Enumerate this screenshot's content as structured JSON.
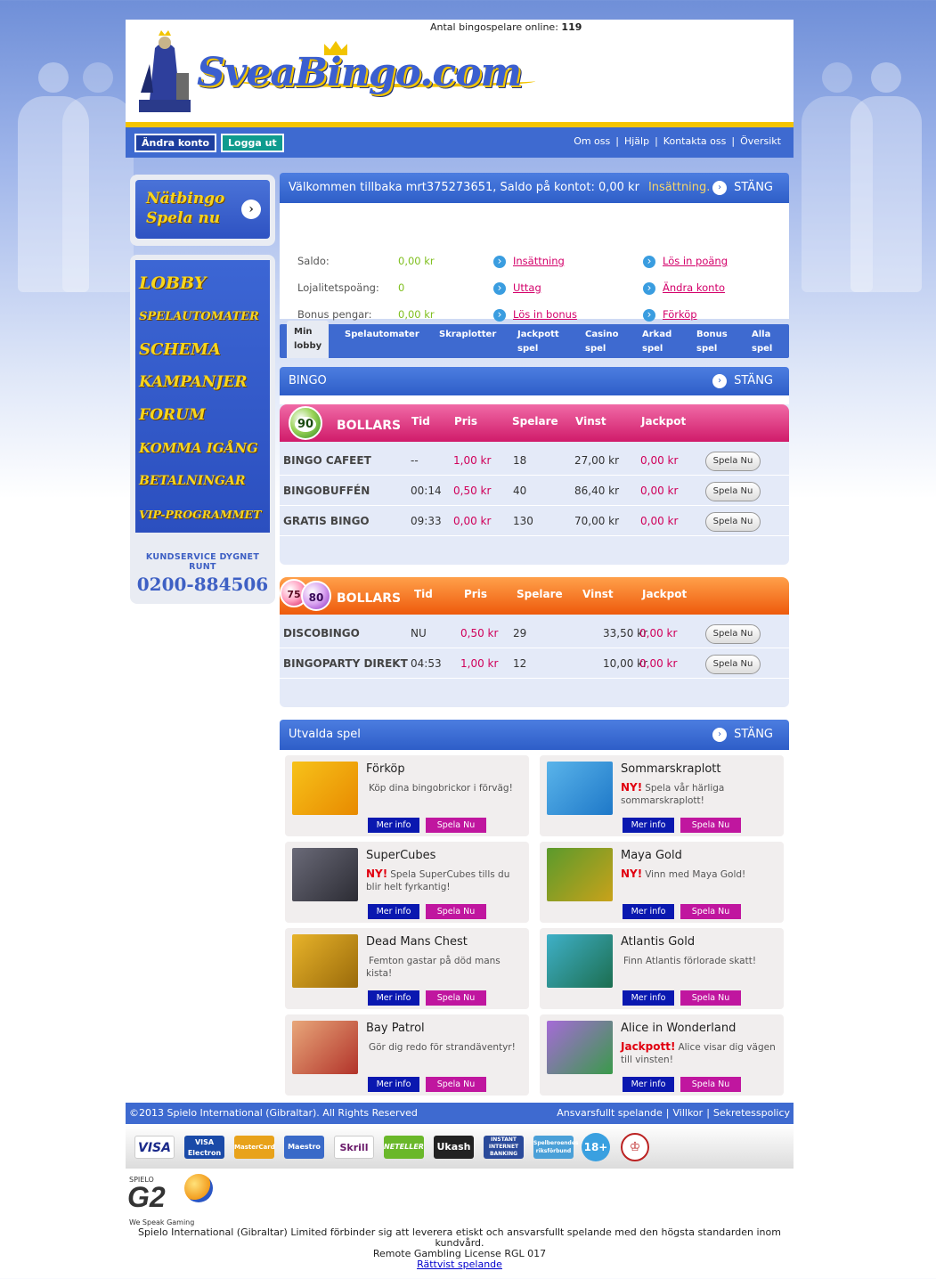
{
  "header": {
    "online_label": "Antal bingospelare online:",
    "online_count": "119",
    "logo_text": "SveaBingo.com"
  },
  "nav": {
    "andra_konto": "Ändra konto",
    "logga_ut": "Logga ut",
    "links": [
      "Om oss",
      "Hjälp",
      "Kontakta oss",
      "Översikt"
    ]
  },
  "left": {
    "natbingo_line1": "Nätbingo",
    "natbingo_line2": "Spela nu",
    "menu": [
      "LOBBY",
      "SPELAUTOMATER",
      "SCHEMA",
      "KAMPANJER",
      "FORUM",
      "KOMMA IGÅNG",
      "BETALNINGAR",
      "VIP-PROGRAMMET"
    ],
    "kundservice_label": "KUNDSERVICE DYGNET RUNT",
    "kundservice_phone": "0200-884506"
  },
  "welcome": {
    "text": "Välkommen tillbaka mrt375273651, Saldo på kontot: 0,00 kr",
    "insattning": "Insättning.",
    "stang": "STÄNG"
  },
  "account": {
    "rows": [
      {
        "label": "Saldo:",
        "value": "0,00 kr",
        "link1": "Insättning",
        "link2": "Lös in poäng"
      },
      {
        "label": "Lojalitetspoäng:",
        "value": "0",
        "link1": "Uttag",
        "link2": "Ändra konto"
      },
      {
        "label": "Bonus pengar:",
        "value": "0,00 kr",
        "link1": "Lös in bonus",
        "link2": "Förköp"
      }
    ]
  },
  "tabs": [
    {
      "line1": "Min",
      "line2": "lobby"
    },
    {
      "line1": "Spelautomater",
      "line2": ""
    },
    {
      "line1": "Skraplotter",
      "line2": ""
    },
    {
      "line1": "Jackpott",
      "line2": "spel"
    },
    {
      "line1": "Casino",
      "line2": "spel"
    },
    {
      "line1": "Arkad",
      "line2": "spel"
    },
    {
      "line1": "Bonus",
      "line2": "spel"
    },
    {
      "line1": "Alla",
      "line2": "spel"
    }
  ],
  "bingo": {
    "title": "BINGO",
    "stang": "STÄNG",
    "headers": {
      "bollars": "BOLLARS",
      "tid": "Tid",
      "pris": "Pris",
      "spelare": "Spelare",
      "vinst": "Vinst",
      "jackpot": "Jackpot"
    },
    "ball90": "90",
    "ball75": "75",
    "ball80": "80",
    "play_label": "Spela Nu",
    "rooms90": [
      {
        "name": "BINGO CAFEET",
        "tid": "--",
        "pris": "1,00 kr",
        "spelare": "18",
        "vinst": "27,00 kr",
        "jackpot": "0,00 kr"
      },
      {
        "name": "BINGOBUFFÉN",
        "tid": "00:14",
        "pris": "0,50 kr",
        "spelare": "40",
        "vinst": "86,40 kr",
        "jackpot": "0,00 kr"
      },
      {
        "name": "GRATIS BINGO",
        "tid": "09:33",
        "pris": "0,00 kr",
        "spelare": "130",
        "vinst": "70,00 kr",
        "jackpot": "0,00 kr"
      }
    ],
    "rooms75": [
      {
        "name": "DISCOBINGO",
        "tid": "NU",
        "pris": "0,50 kr",
        "spelare": "29",
        "vinst": "33,50 kr",
        "jackpot": "0,00 kr"
      },
      {
        "name": "BINGOPARTY DIREKT",
        "tid": "04:53",
        "pris": "1,00 kr",
        "spelare": "12",
        "vinst": "10,00 kr",
        "jackpot": "0,00 kr"
      }
    ]
  },
  "featured": {
    "title": "Utvalda spel",
    "stang": "STÄNG",
    "mer_info": "Mer info",
    "spela_nu": "Spela Nu",
    "games": [
      {
        "title": "Förköp",
        "ny": "",
        "desc": "Köp dina bingobrickor i förväg!",
        "color1": "#f7c21a",
        "color2": "#e88a00"
      },
      {
        "title": "Sommarskraplott",
        "ny": "NY!",
        "desc": "Spela vår härliga sommarskraplott!",
        "color1": "#5ab4ea",
        "color2": "#1e78c8"
      },
      {
        "title": "SuperCubes",
        "ny": "NY!",
        "desc": "Spela SuperCubes tills du blir helt fyrkantig!",
        "color1": "#6a6a78",
        "color2": "#2c2c34"
      },
      {
        "title": "Maya Gold",
        "ny": "NY!",
        "desc": "Vinn med Maya Gold!",
        "color1": "#5a9a2c",
        "color2": "#c9a21a"
      },
      {
        "title": "Dead Mans Chest",
        "ny": "",
        "desc": "Femton gastar på död mans kista!",
        "color1": "#e7b32a",
        "color2": "#9a6a0a"
      },
      {
        "title": "Atlantis Gold",
        "ny": "",
        "desc": "Finn Atlantis förlorade skatt!",
        "color1": "#3fb0c8",
        "color2": "#1c6e50"
      },
      {
        "title": "Bay Patrol",
        "ny": "",
        "desc": "Gör dig redo för strandäventyr!",
        "color1": "#e8a77a",
        "color2": "#b2332a"
      },
      {
        "title": "Alice in Wonderland",
        "ny": "Jackpott!",
        "desc": "Alice visar dig vägen till vinsten!",
        "color1": "#a66ad8",
        "color2": "#3a9a4a"
      }
    ]
  },
  "footer": {
    "copyright": "©2013 Spielo International (Gibraltar). All Rights Reserved",
    "links": [
      "Ansvarsfullt spelande",
      "Villkor",
      "Sekretesspolicy"
    ],
    "payments": [
      "VISA",
      "VISA Electron",
      "MasterCard",
      "Maestro",
      "Skrill",
      "NETELLER",
      "Ukash",
      "INSTANT INTERNET BANKING",
      "Spelberoendes riksförbund",
      "18+",
      "crest"
    ],
    "g2_sp": "SPIELO",
    "g2": "G2",
    "g2_tag": "We Speak Gaming",
    "legal1": "Spielo International (Gibraltar) Limited förbinder sig att leverera etiskt och ansvarsfullt spelande med den högsta standarden inom kundvård.",
    "legal2": "Remote Gambling License RGL 017",
    "legal3": "Rättvist spelande"
  }
}
